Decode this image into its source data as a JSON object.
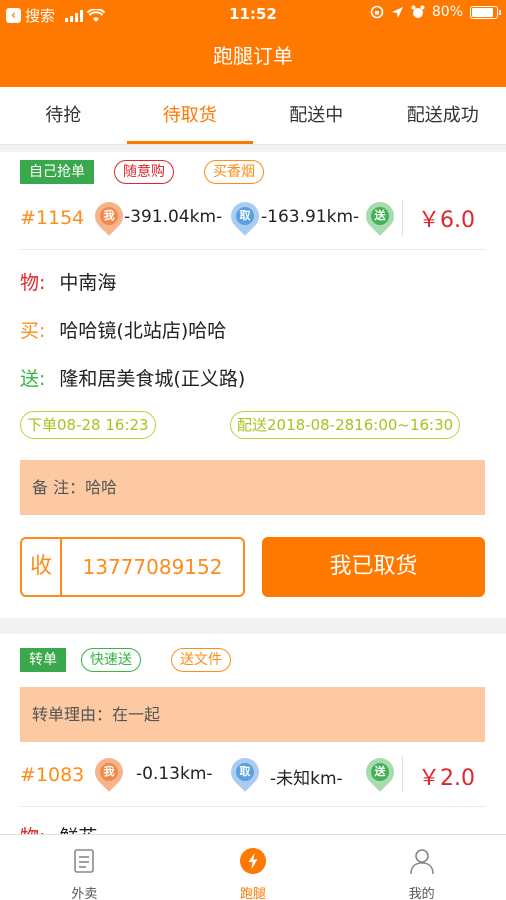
{
  "status_bar": {
    "back_app": "搜索",
    "time": "11:52",
    "battery": "80%"
  },
  "header": {
    "title": "跑腿订单"
  },
  "tabs": [
    {
      "label": "待抢",
      "active": false
    },
    {
      "label": "待取货",
      "active": true
    },
    {
      "label": "配送中",
      "active": false
    },
    {
      "label": "配送成功",
      "active": false
    }
  ],
  "order1": {
    "type_tag": "自己抢单",
    "tags": [
      "随意购",
      "买香烟"
    ],
    "number": "#1154",
    "pin_wo": "我",
    "pin_qu": "取",
    "pin_song": "送",
    "dist1": "-391.04km-",
    "dist2": "-163.91km-",
    "price": "￥6.0",
    "item_label": "物:",
    "item": "中南海",
    "buy_label": "买:",
    "buy": "哈哈镜(北站店)哈哈",
    "deliver_label": "送:",
    "deliver": "隆和居美食城(正义路)",
    "order_time": "下单08-28 16:23",
    "delivery_time": "配送2018-08-2816:00~16:30",
    "remark": "备 注：哈哈",
    "receive_label": "收",
    "phone": "13777089152",
    "action": "我已取货"
  },
  "order2": {
    "type_tag": "转单",
    "tags": [
      "快速送",
      "送文件"
    ],
    "reason": "转单理由：在一起",
    "number": "#1083",
    "pin_wo": "我",
    "pin_qu": "取",
    "pin_song": "送",
    "dist1": "-0.13km-",
    "dist2": "-未知km-",
    "price": "￥2.0",
    "item_label": "物:",
    "item": "鲜花"
  },
  "bottom_nav": [
    {
      "label": "外卖",
      "icon": "document-icon",
      "active": false
    },
    {
      "label": "跑腿",
      "icon": "lightning-icon",
      "active": true
    },
    {
      "label": "我的",
      "icon": "person-icon",
      "active": false
    }
  ],
  "colors": {
    "brand": "#ff7800",
    "price": "#e0262b",
    "remark_bg": "#fcc9a2"
  }
}
